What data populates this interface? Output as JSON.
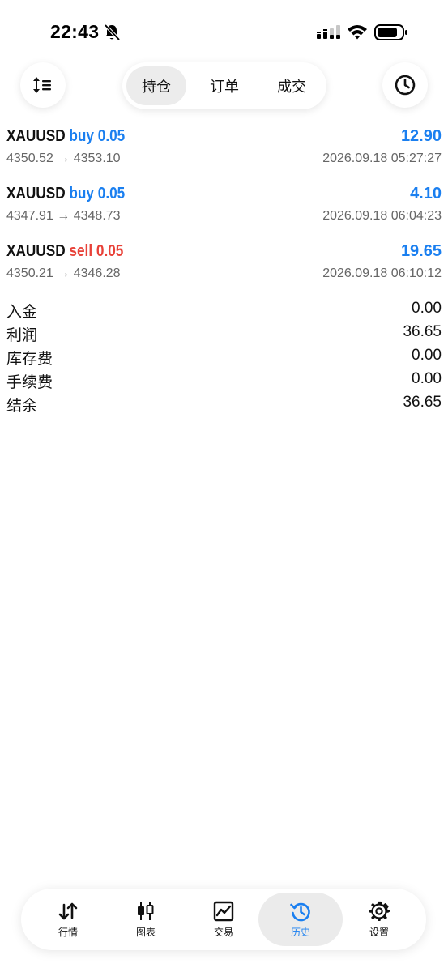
{
  "status_bar": {
    "time": "22:43"
  },
  "toolbar": {
    "sort_icon": "sort-icon",
    "clock_icon": "clock-icon",
    "tabs": [
      {
        "label": "持仓",
        "active": true
      },
      {
        "label": "订单",
        "active": false
      },
      {
        "label": "成交",
        "active": false
      }
    ]
  },
  "deals": [
    {
      "symbol": "XAUUSD",
      "side": "buy",
      "volume": "buy 0.05",
      "profit": "12.90",
      "prices": "4350.52 → 4353.10",
      "time": "2026.09.18 05:27:27"
    },
    {
      "symbol": "XAUUSD",
      "side": "buy",
      "volume": "buy 0.05",
      "profit": "4.10",
      "prices": "4347.91 → 4348.73",
      "time": "2026.09.18 06:04:23"
    },
    {
      "symbol": "XAUUSD",
      "side": "sell",
      "volume": "sell 0.05",
      "profit": "19.65",
      "prices": "4350.21 → 4346.28",
      "time": "2026.09.18 06:10:12"
    }
  ],
  "summary": [
    {
      "label": "入金",
      "value": "0.00"
    },
    {
      "label": "利润",
      "value": "36.65"
    },
    {
      "label": "库存费",
      "value": "0.00"
    },
    {
      "label": "手续费",
      "value": "0.00"
    },
    {
      "label": "结余",
      "value": "36.65"
    }
  ],
  "bottom_nav": [
    {
      "label": "行情",
      "icon": "quotes-icon",
      "active": false
    },
    {
      "label": "图表",
      "icon": "chart-icon",
      "active": false
    },
    {
      "label": "交易",
      "icon": "trade-icon",
      "active": false
    },
    {
      "label": "历史",
      "icon": "history-icon",
      "active": true
    },
    {
      "label": "设置",
      "icon": "settings-icon",
      "active": false
    }
  ],
  "colors": {
    "accent": "#1a7ff0",
    "sell": "#e84138",
    "muted": "#666666"
  }
}
